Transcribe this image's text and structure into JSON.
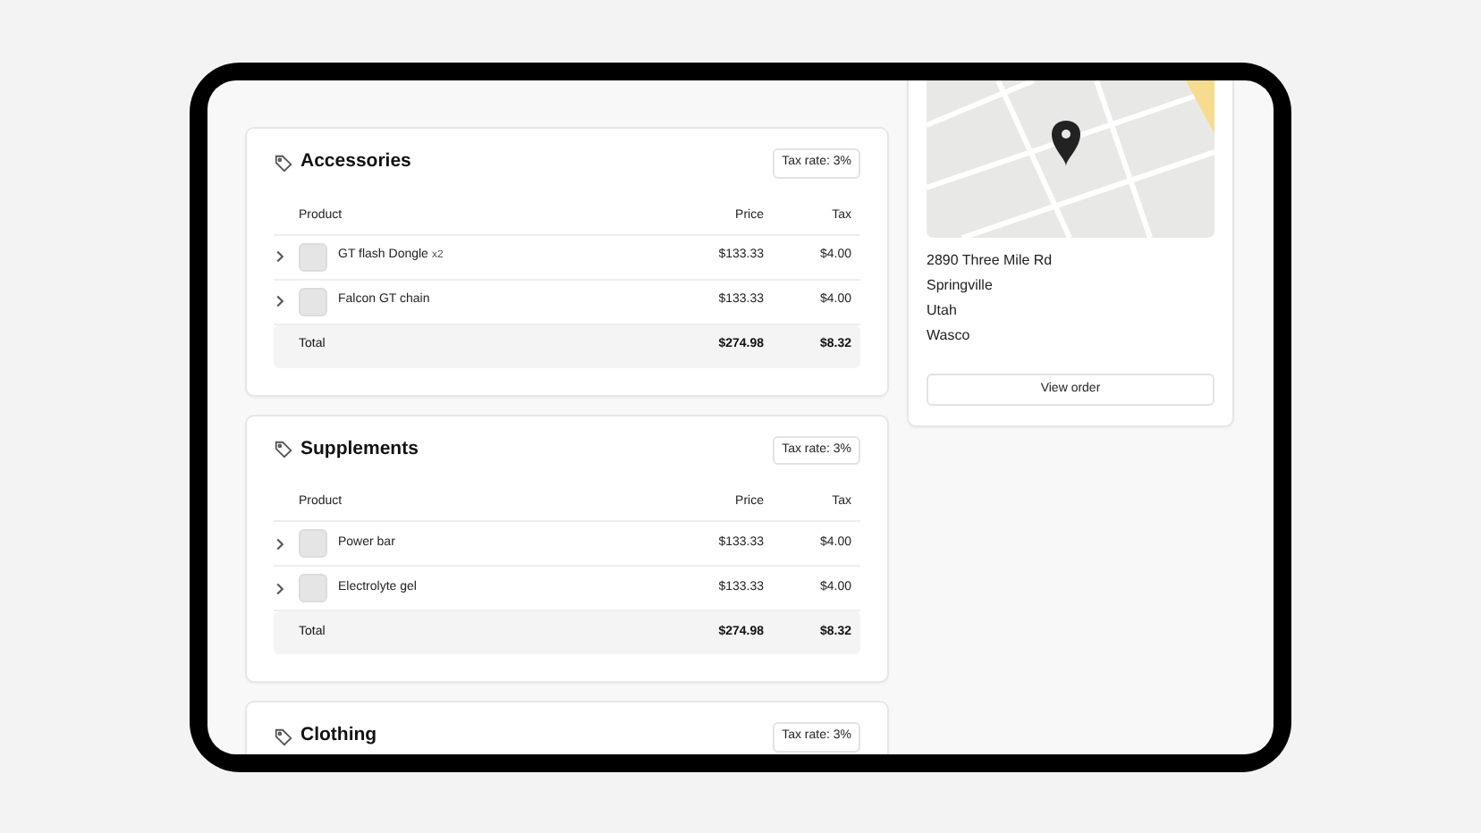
{
  "sections": [
    {
      "title": "Accessories",
      "tax_badge": "Tax rate: 3%",
      "columns": [
        "Product",
        "Price",
        "Tax"
      ],
      "rows": [
        {
          "product": "GT flash Dongle",
          "quantity": "x2",
          "price": "$133.33",
          "tax": "$4.00"
        },
        {
          "product": "Falcon GT chain",
          "price": "$133.33",
          "tax": "$4.00"
        }
      ],
      "total": {
        "label": "Total",
        "price": "$274.98",
        "tax": "$8.32"
      }
    },
    {
      "title": "Supplements",
      "tax_badge": "Tax rate: 3%",
      "columns": [
        "Product",
        "Price",
        "Tax"
      ],
      "rows": [
        {
          "product": "Power bar",
          "price": "$133.33",
          "tax": "$4.00"
        },
        {
          "product": "Electrolyte gel",
          "price": "$133.33",
          "tax": "$4.00"
        }
      ],
      "total": {
        "label": "Total",
        "price": "$274.98",
        "tax": "$8.32"
      }
    },
    {
      "title": "Clothing",
      "tax_badge": "Tax rate: 3%"
    }
  ],
  "address": {
    "lines": [
      "2890 Three Mile Rd",
      "Springville",
      "Utah",
      "Wasco"
    ],
    "button": "View order"
  }
}
